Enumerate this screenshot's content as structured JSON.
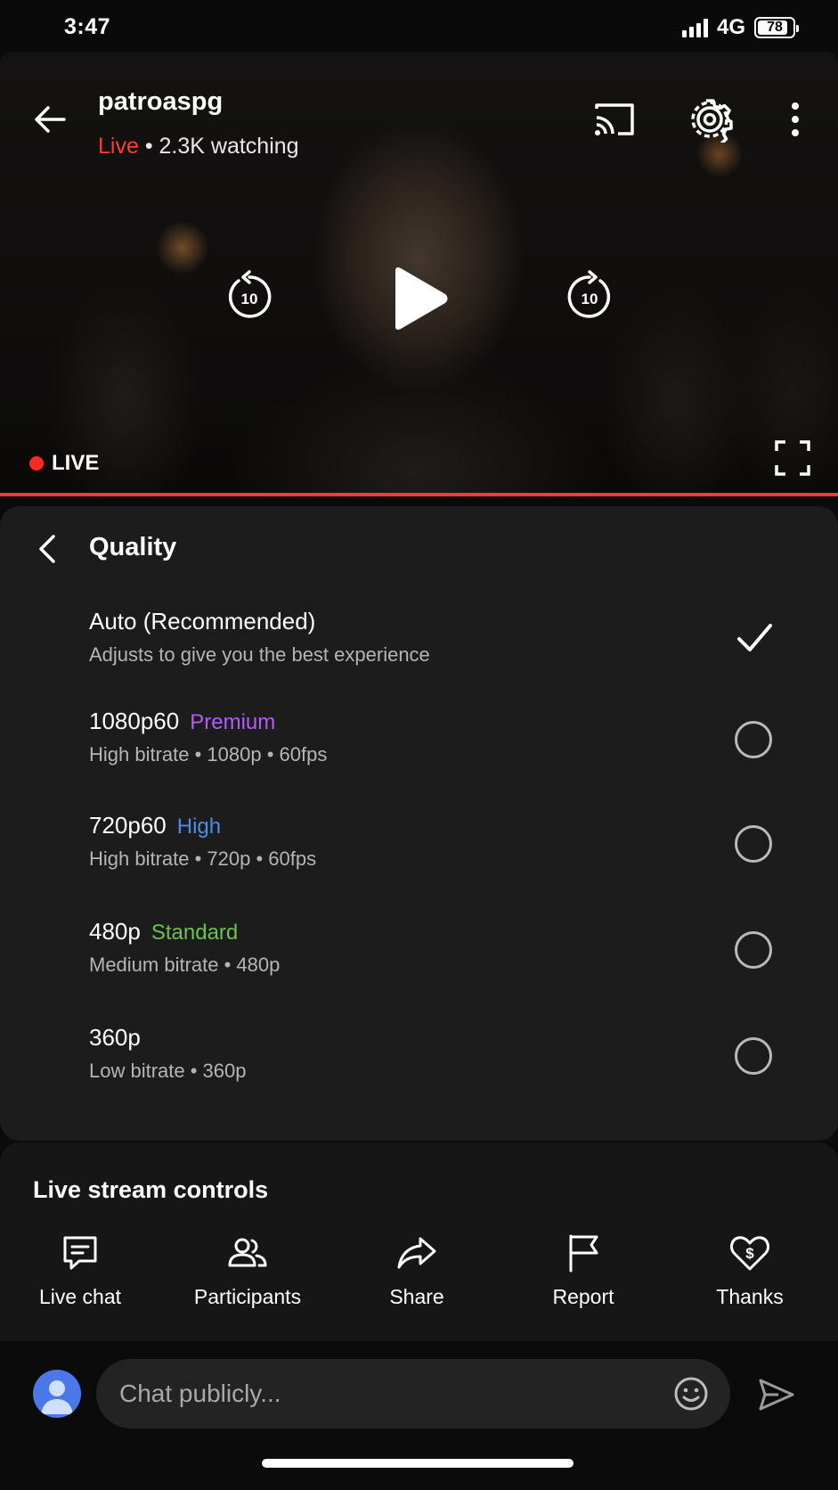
{
  "status_bar": {
    "time": "3:47",
    "network": "4G",
    "battery": "78"
  },
  "video": {
    "channel_name": "patroaspg",
    "live_label": "Live",
    "watching": "• 2.3K watching",
    "live_badge": "LIVE",
    "rewind_seconds": "10",
    "forward_seconds": "10",
    "progress_color": "#ff3b30"
  },
  "quality": {
    "title": "Quality",
    "options": [
      {
        "label": "Auto (Recommended)",
        "tag": "",
        "tag_color": "",
        "sub": "Adjusts to give you the best experience",
        "selected": true
      },
      {
        "label": "1080p60",
        "tag": "Premium",
        "tag_color": "#b45cf6",
        "sub": "High bitrate • 1080p • 60fps",
        "selected": false
      },
      {
        "label": "720p60",
        "tag": "High",
        "tag_color": "#4a90e2",
        "sub": "High bitrate • 720p • 60fps",
        "selected": false
      },
      {
        "label": "480p",
        "tag": "Standard",
        "tag_color": "#6cc24a",
        "sub": "Medium bitrate • 480p",
        "selected": false
      },
      {
        "label": "360p",
        "tag": "",
        "tag_color": "",
        "sub": "Low bitrate • 360p",
        "selected": false
      }
    ]
  },
  "controls": {
    "title": "Live stream controls",
    "items": [
      {
        "label": "Live chat",
        "icon": "chat-icon"
      },
      {
        "label": "Participants",
        "icon": "participants-icon"
      },
      {
        "label": "Share",
        "icon": "share-icon"
      },
      {
        "label": "Report",
        "icon": "flag-icon"
      },
      {
        "label": "Thanks",
        "icon": "heart-dollar-icon"
      }
    ]
  },
  "chat": {
    "placeholder": "Chat publicly..."
  }
}
